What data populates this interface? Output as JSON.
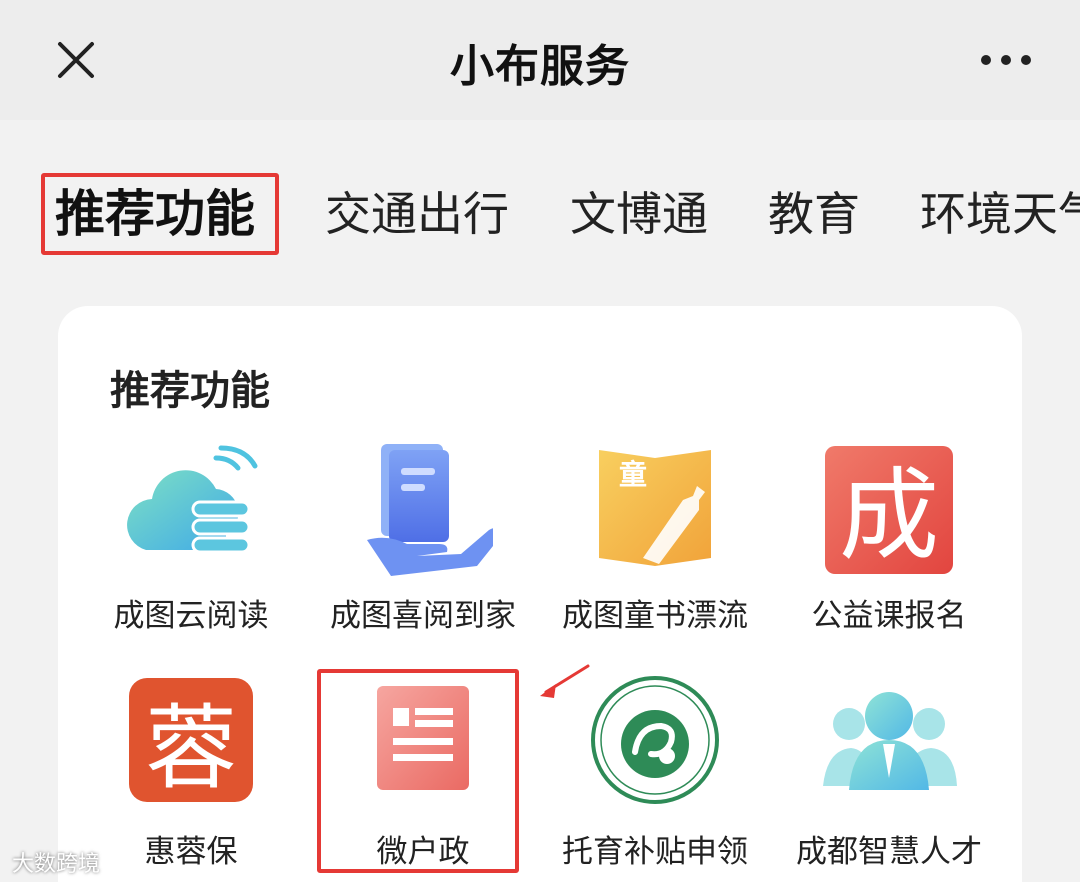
{
  "header": {
    "title": "小布服务",
    "close_icon": "close-icon",
    "more_icon": "more-icon"
  },
  "tabs": [
    {
      "label": "推荐功能",
      "active": true
    },
    {
      "label": "交通出行",
      "active": false
    },
    {
      "label": "文博通",
      "active": false
    },
    {
      "label": "教育",
      "active": false
    },
    {
      "label": "环境天气",
      "active": false
    }
  ],
  "section": {
    "title": "推荐功能",
    "items": [
      {
        "label": "成图云阅读",
        "icon": "cloud-reading-icon"
      },
      {
        "label": "成图喜阅到家",
        "icon": "book-delivery-icon"
      },
      {
        "label": "成图童书漂流",
        "icon": "children-book-drift-icon"
      },
      {
        "label": "公益课报名",
        "icon": "charity-class-icon"
      },
      {
        "label": "惠蓉保",
        "icon": "huirongbao-icon"
      },
      {
        "label": "微户政",
        "icon": "micro-household-icon"
      },
      {
        "label": "托育补贴申领",
        "icon": "childcare-subsidy-icon"
      },
      {
        "label": "成都智慧人才",
        "icon": "smart-talent-icon"
      }
    ],
    "icon_glyphs": {
      "children_book": "童",
      "charity": "成",
      "huirong": "蓉"
    }
  },
  "colors": {
    "accent_red": "#e53935",
    "background": "#f2f2f2",
    "card": "#ffffff"
  },
  "watermark": "大数跨境"
}
